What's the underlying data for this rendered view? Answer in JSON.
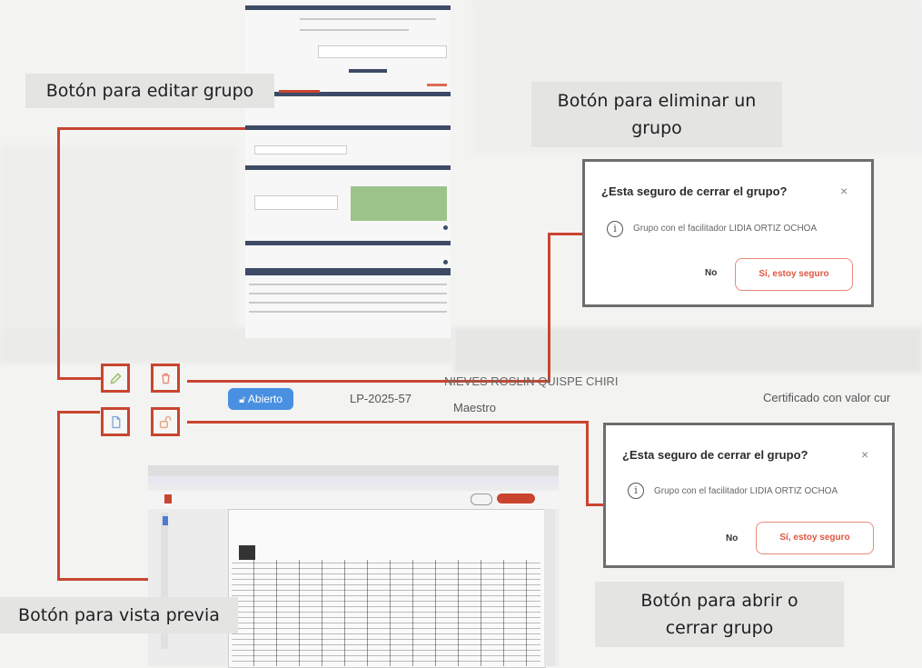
{
  "callouts": {
    "edit": "Botón para editar grupo",
    "delete_line1": "Botón para eliminar un",
    "delete_line2": "grupo",
    "preview": "Botón para vista previa",
    "toggle_line1": "Botón para abrir o",
    "toggle_line2": "cerrar grupo"
  },
  "dialog_top": {
    "title": "¿Esta seguro de cerrar el grupo?",
    "close_icon": "×",
    "info_icon": "i",
    "message": "Grupo con el facilitador LIDIA ORTIZ OCHOA",
    "no_label": "No",
    "yes_label": "Sí, estoy seguro"
  },
  "dialog_bottom": {
    "title": "¿Esta seguro de cerrar el grupo?",
    "close_icon": "×",
    "info_icon": "i",
    "message": "Grupo con el facilitador LIDIA ORTIZ OCHOA",
    "no_label": "No",
    "yes_label": "Sí, estoy seguro"
  },
  "row": {
    "status": "Abierto",
    "code": "LP-2025-57",
    "facilitator": "NIEVES ROSLIN QUISPE CHIRI",
    "role": "Maestro",
    "certificate": "Certificado con valor cur"
  },
  "icons": {
    "edit": "pencil-icon",
    "delete": "trash-icon",
    "preview": "document-icon",
    "toggle": "lock-open-icon"
  },
  "colors": {
    "accent": "#c9452f",
    "status_badge": "#4a90e2",
    "confirm_text": "#e0553f"
  }
}
